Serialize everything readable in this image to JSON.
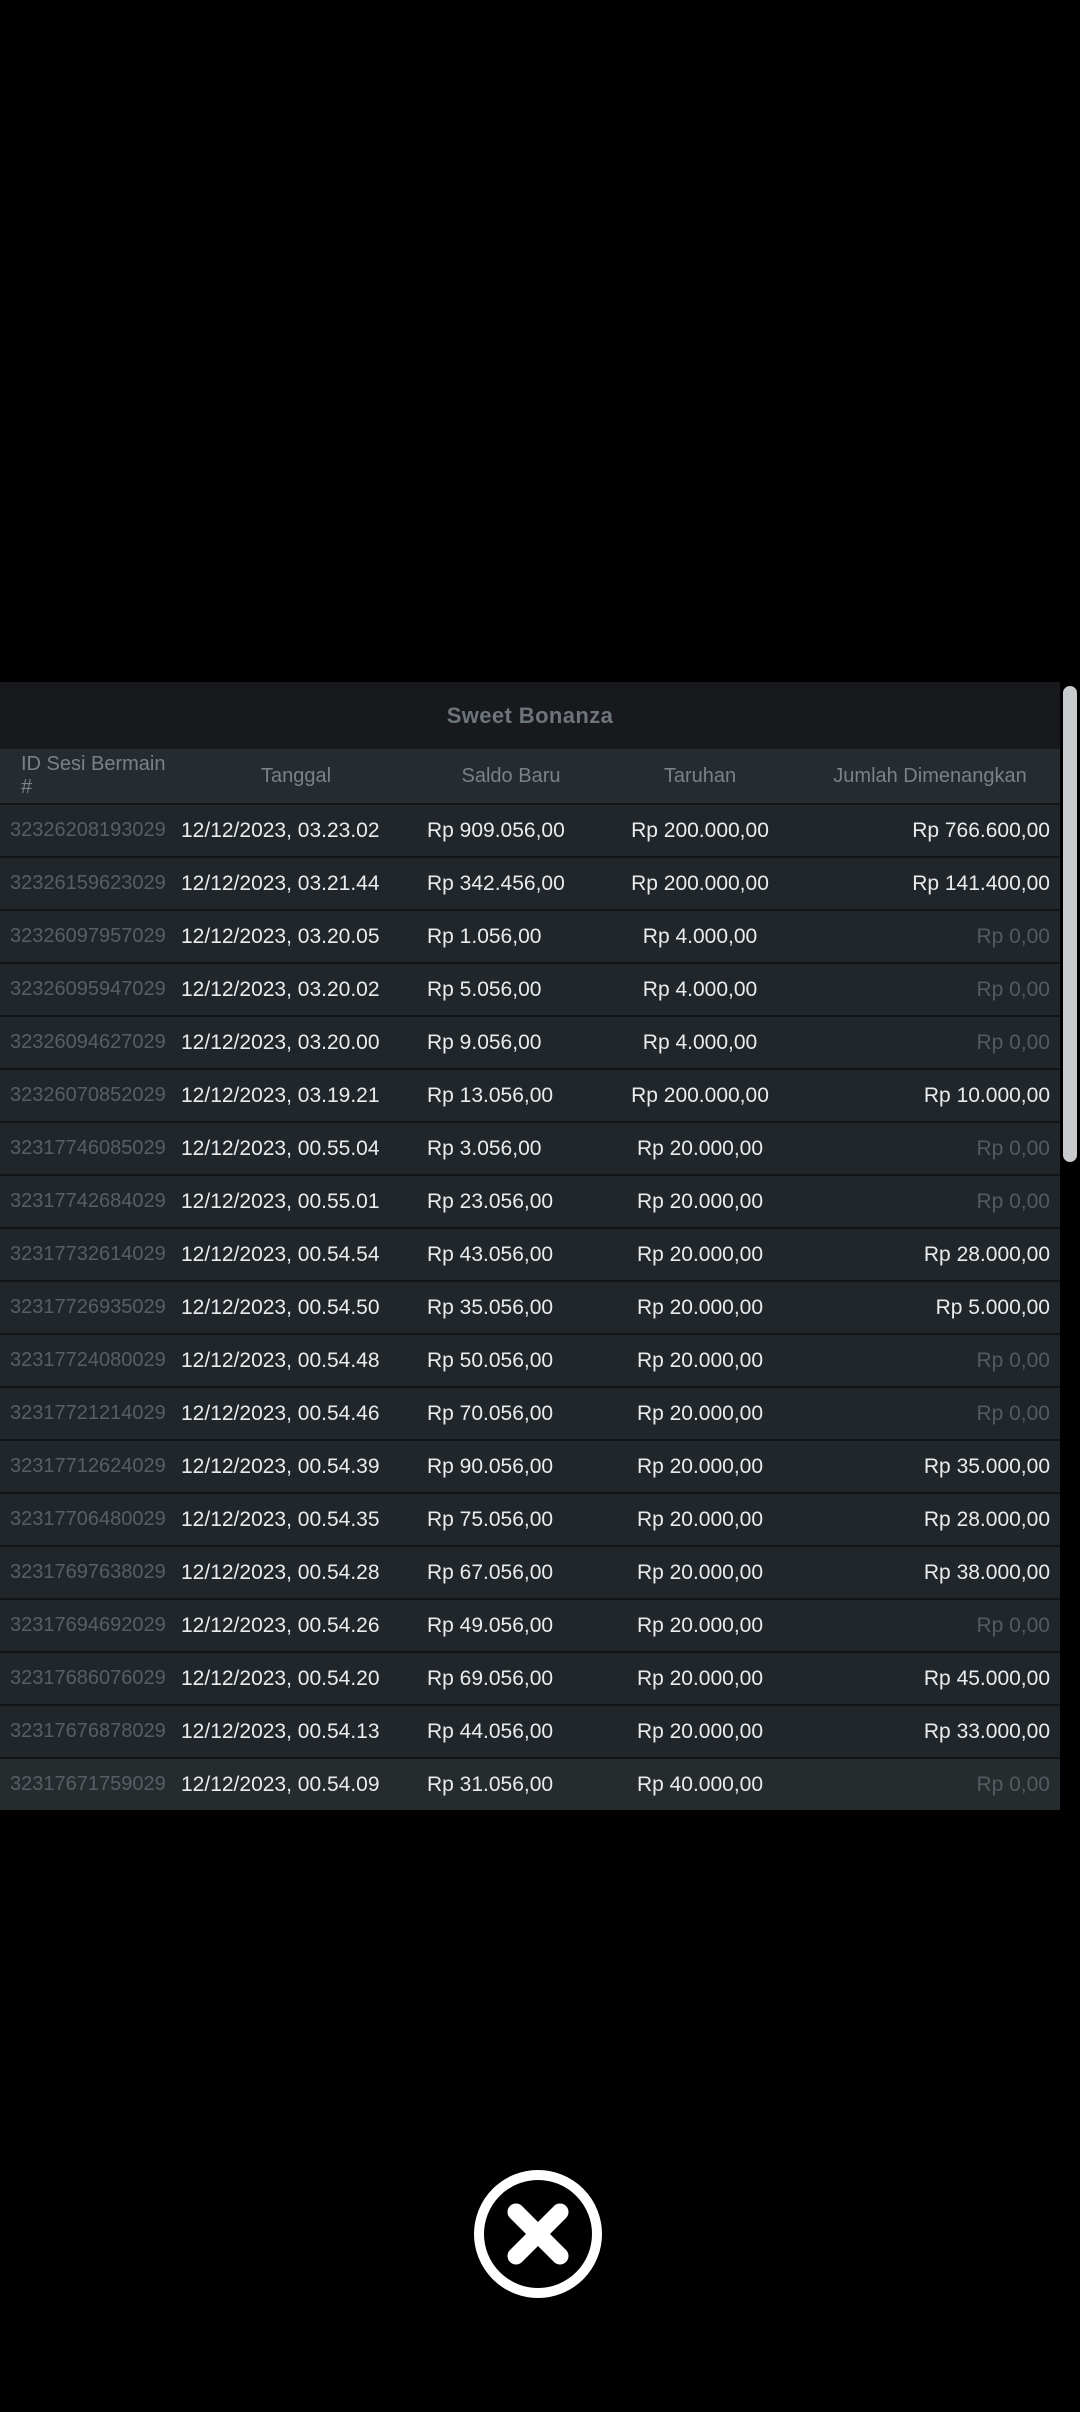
{
  "modal": {
    "title": "Sweet Bonanza"
  },
  "table": {
    "headers": [
      "ID Sesi Bermain #",
      "Tanggal",
      "Saldo Baru",
      "Taruhan",
      "Jumlah Dimenangkan"
    ],
    "rows": [
      {
        "id": "32326208193029",
        "date": "12/12/2023, 03.23.02",
        "balance": "Rp 909.056,00",
        "bet": "Rp 200.000,00",
        "win": "Rp 766.600,00"
      },
      {
        "id": "32326159623029",
        "date": "12/12/2023, 03.21.44",
        "balance": "Rp 342.456,00",
        "bet": "Rp 200.000,00",
        "win": "Rp 141.400,00"
      },
      {
        "id": "32326097957029",
        "date": "12/12/2023, 03.20.05",
        "balance": "Rp 1.056,00",
        "bet": "Rp 4.000,00",
        "win": "Rp 0,00"
      },
      {
        "id": "32326095947029",
        "date": "12/12/2023, 03.20.02",
        "balance": "Rp 5.056,00",
        "bet": "Rp 4.000,00",
        "win": "Rp 0,00"
      },
      {
        "id": "32326094627029",
        "date": "12/12/2023, 03.20.00",
        "balance": "Rp 9.056,00",
        "bet": "Rp 4.000,00",
        "win": "Rp 0,00"
      },
      {
        "id": "32326070852029",
        "date": "12/12/2023, 03.19.21",
        "balance": "Rp 13.056,00",
        "bet": "Rp 200.000,00",
        "win": "Rp 10.000,00"
      },
      {
        "id": "32317746085029",
        "date": "12/12/2023, 00.55.04",
        "balance": "Rp 3.056,00",
        "bet": "Rp 20.000,00",
        "win": "Rp 0,00"
      },
      {
        "id": "32317742684029",
        "date": "12/12/2023, 00.55.01",
        "balance": "Rp 23.056,00",
        "bet": "Rp 20.000,00",
        "win": "Rp 0,00"
      },
      {
        "id": "32317732614029",
        "date": "12/12/2023, 00.54.54",
        "balance": "Rp 43.056,00",
        "bet": "Rp 20.000,00",
        "win": "Rp 28.000,00"
      },
      {
        "id": "32317726935029",
        "date": "12/12/2023, 00.54.50",
        "balance": "Rp 35.056,00",
        "bet": "Rp 20.000,00",
        "win": "Rp 5.000,00"
      },
      {
        "id": "32317724080029",
        "date": "12/12/2023, 00.54.48",
        "balance": "Rp 50.056,00",
        "bet": "Rp 20.000,00",
        "win": "Rp 0,00"
      },
      {
        "id": "32317721214029",
        "date": "12/12/2023, 00.54.46",
        "balance": "Rp 70.056,00",
        "bet": "Rp 20.000,00",
        "win": "Rp 0,00"
      },
      {
        "id": "32317712624029",
        "date": "12/12/2023, 00.54.39",
        "balance": "Rp 90.056,00",
        "bet": "Rp 20.000,00",
        "win": "Rp 35.000,00"
      },
      {
        "id": "32317706480029",
        "date": "12/12/2023, 00.54.35",
        "balance": "Rp 75.056,00",
        "bet": "Rp 20.000,00",
        "win": "Rp 28.000,00"
      },
      {
        "id": "32317697638029",
        "date": "12/12/2023, 00.54.28",
        "balance": "Rp 67.056,00",
        "bet": "Rp 20.000,00",
        "win": "Rp 38.000,00"
      },
      {
        "id": "32317694692029",
        "date": "12/12/2023, 00.54.26",
        "balance": "Rp 49.056,00",
        "bet": "Rp 20.000,00",
        "win": "Rp 0,00"
      },
      {
        "id": "32317686076029",
        "date": "12/12/2023, 00.54.20",
        "balance": "Rp 69.056,00",
        "bet": "Rp 20.000,00",
        "win": "Rp 45.000,00"
      },
      {
        "id": "32317676878029",
        "date": "12/12/2023, 00.54.13",
        "balance": "Rp 44.056,00",
        "bet": "Rp 20.000,00",
        "win": "Rp 33.000,00"
      },
      {
        "id": "32317671759029",
        "date": "12/12/2023, 00.54.09",
        "balance": "Rp 31.056,00",
        "bet": "Rp 40.000,00",
        "win": "Rp 0,00"
      }
    ],
    "zero_value": "Rp 0,00"
  },
  "icons": {
    "close": "close-icon"
  },
  "colors": {
    "background": "#000000",
    "title_bar_bg": "#17191c",
    "header_bg": "#262b2f",
    "row_bg": "#21262a",
    "text_primary": "#e9ecee",
    "text_dim": "#575f66",
    "win_zero_dim": "#535b61",
    "scrollbar_thumb": "#c8cacc",
    "close_button": "#ffffff"
  }
}
